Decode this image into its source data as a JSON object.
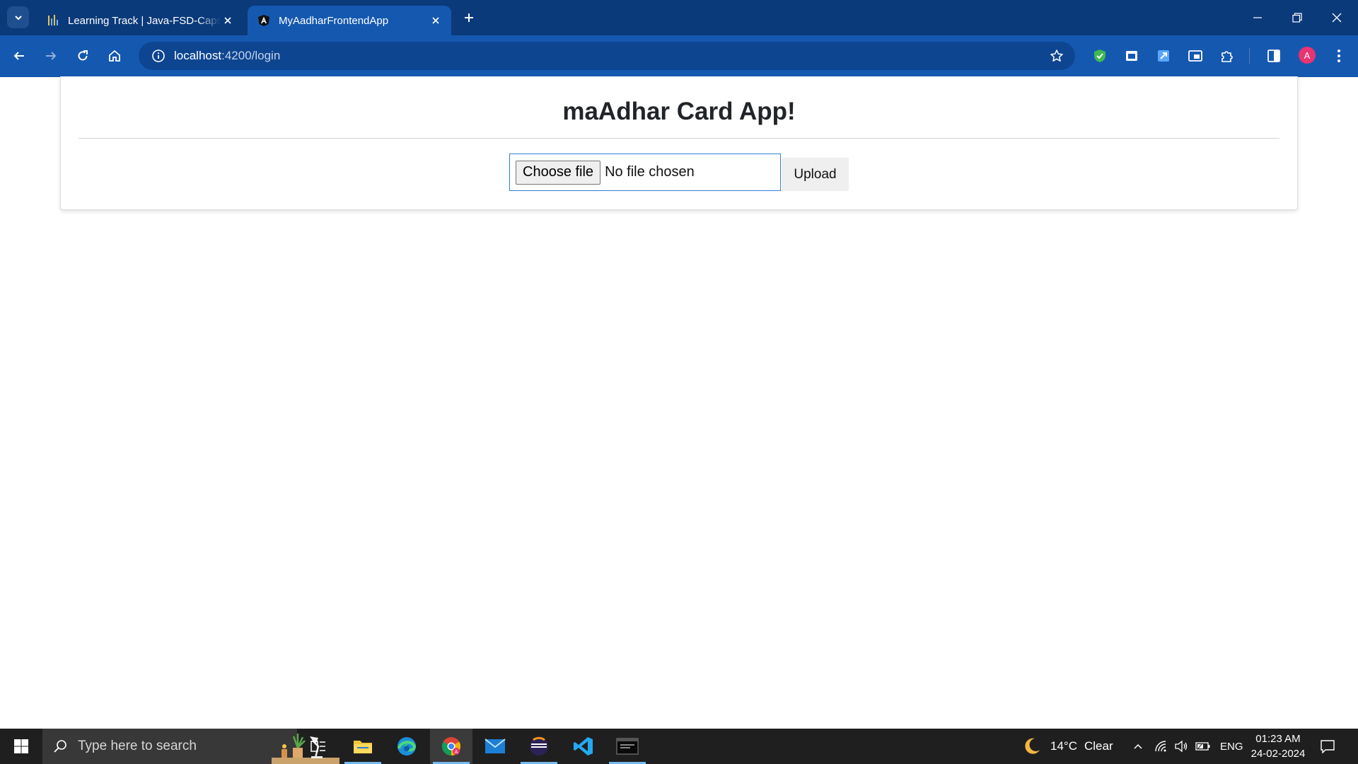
{
  "browser": {
    "tabs": [
      {
        "title": "Learning Track | Java-FSD-Capst",
        "active": false
      },
      {
        "title": "MyAadharFrontendApp",
        "active": true
      }
    ],
    "url_host": "localhost",
    "url_rest": ":4200/login",
    "profile_initial": "A",
    "accent_color": "#1558b0",
    "tabbar_color": "#0b3a7a"
  },
  "page": {
    "heading": "maAdhar Card App!",
    "file_input": {
      "button_label": "Choose file",
      "status": "No file chosen"
    },
    "upload_label": "Upload"
  },
  "taskbar": {
    "search_placeholder": "Type here to search",
    "weather_temp": "14°C",
    "weather_desc": "Clear",
    "language": "ENG",
    "time": "01:23 AM",
    "date": "24-02-2024",
    "apps": [
      "task-view",
      "file-explorer",
      "edge",
      "chrome",
      "mail",
      "eclipse",
      "vscode",
      "mysql"
    ]
  }
}
